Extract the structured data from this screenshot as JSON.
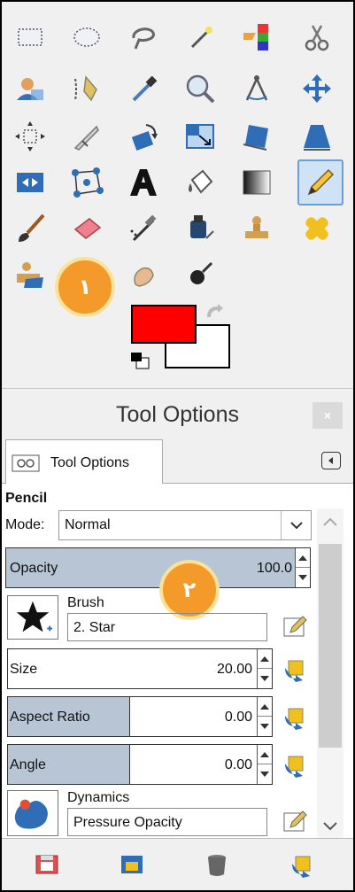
{
  "toolbox": {
    "tools": [
      {
        "id": "rect-select",
        "icon": "rectangle-select-icon"
      },
      {
        "id": "ellipse-select",
        "icon": "ellipse-select-icon"
      },
      {
        "id": "free-select",
        "icon": "lasso-select-icon"
      },
      {
        "id": "fuzzy-select",
        "icon": "magic-wand-icon"
      },
      {
        "id": "color-select",
        "icon": "select-by-color-icon"
      },
      {
        "id": "scissors",
        "icon": "scissors-select-icon"
      },
      {
        "id": "foreground-select",
        "icon": "foreground-select-icon"
      },
      {
        "id": "paths",
        "icon": "paths-pen-icon"
      },
      {
        "id": "color-picker",
        "icon": "eyedropper-icon"
      },
      {
        "id": "zoom",
        "icon": "zoom-magnifier-icon"
      },
      {
        "id": "measure",
        "icon": "compass-measure-icon"
      },
      {
        "id": "move",
        "icon": "move-arrows-icon"
      },
      {
        "id": "align",
        "icon": "align-icon"
      },
      {
        "id": "crop",
        "icon": "crop-knife-icon"
      },
      {
        "id": "rotate",
        "icon": "rotate-icon"
      },
      {
        "id": "scale",
        "icon": "scale-icon"
      },
      {
        "id": "shear",
        "icon": "shear-icon"
      },
      {
        "id": "perspective",
        "icon": "perspective-icon"
      },
      {
        "id": "flip",
        "icon": "flip-icon"
      },
      {
        "id": "cage",
        "icon": "cage-transform-icon"
      },
      {
        "id": "text",
        "icon": "text-a-icon"
      },
      {
        "id": "bucket-fill",
        "icon": "bucket-fill-icon"
      },
      {
        "id": "blend",
        "icon": "gradient-icon"
      },
      {
        "id": "pencil",
        "icon": "pencil-icon",
        "active": true
      },
      {
        "id": "paintbrush",
        "icon": "paintbrush-icon"
      },
      {
        "id": "eraser",
        "icon": "eraser-icon"
      },
      {
        "id": "airbrush",
        "icon": "airbrush-icon"
      },
      {
        "id": "ink",
        "icon": "ink-bottle-icon"
      },
      {
        "id": "clone",
        "icon": "clone-stamp-icon"
      },
      {
        "id": "heal",
        "icon": "heal-bandage-icon"
      },
      {
        "id": "perspective-clone",
        "icon": "perspective-clone-icon"
      },
      {
        "id": "blur",
        "icon": "blur-drop-icon"
      },
      {
        "id": "smudge",
        "icon": "smudge-finger-icon"
      },
      {
        "id": "dodge-burn",
        "icon": "dodge-burn-icon"
      }
    ],
    "badge1": "١",
    "foreground_color": "#ff0000",
    "background_color": "#ffffff"
  },
  "dock": {
    "title": "Tool Options",
    "close_label": "×",
    "tab_label": "Tool Options"
  },
  "options": {
    "tool_name": "Pencil",
    "mode_label": "Mode:",
    "mode_value": "Normal",
    "opacity_label": "Opacity",
    "opacity_value": "100.0",
    "opacity_fraction": 1.0,
    "brush_label": "Brush",
    "brush_name": "2. Star",
    "size_label": "Size",
    "size_value": "20.00",
    "aspect_label": "Aspect Ratio",
    "aspect_value": "0.00",
    "angle_label": "Angle",
    "angle_value": "0.00",
    "dynamics_label": "Dynamics",
    "dynamics_name": "Pressure Opacity",
    "badge2": "٢"
  },
  "colors": {
    "accent_blue": "#b7c5d4",
    "badge_orange": "#f39a2b",
    "active_tool_bg": "#cfe2f6"
  }
}
